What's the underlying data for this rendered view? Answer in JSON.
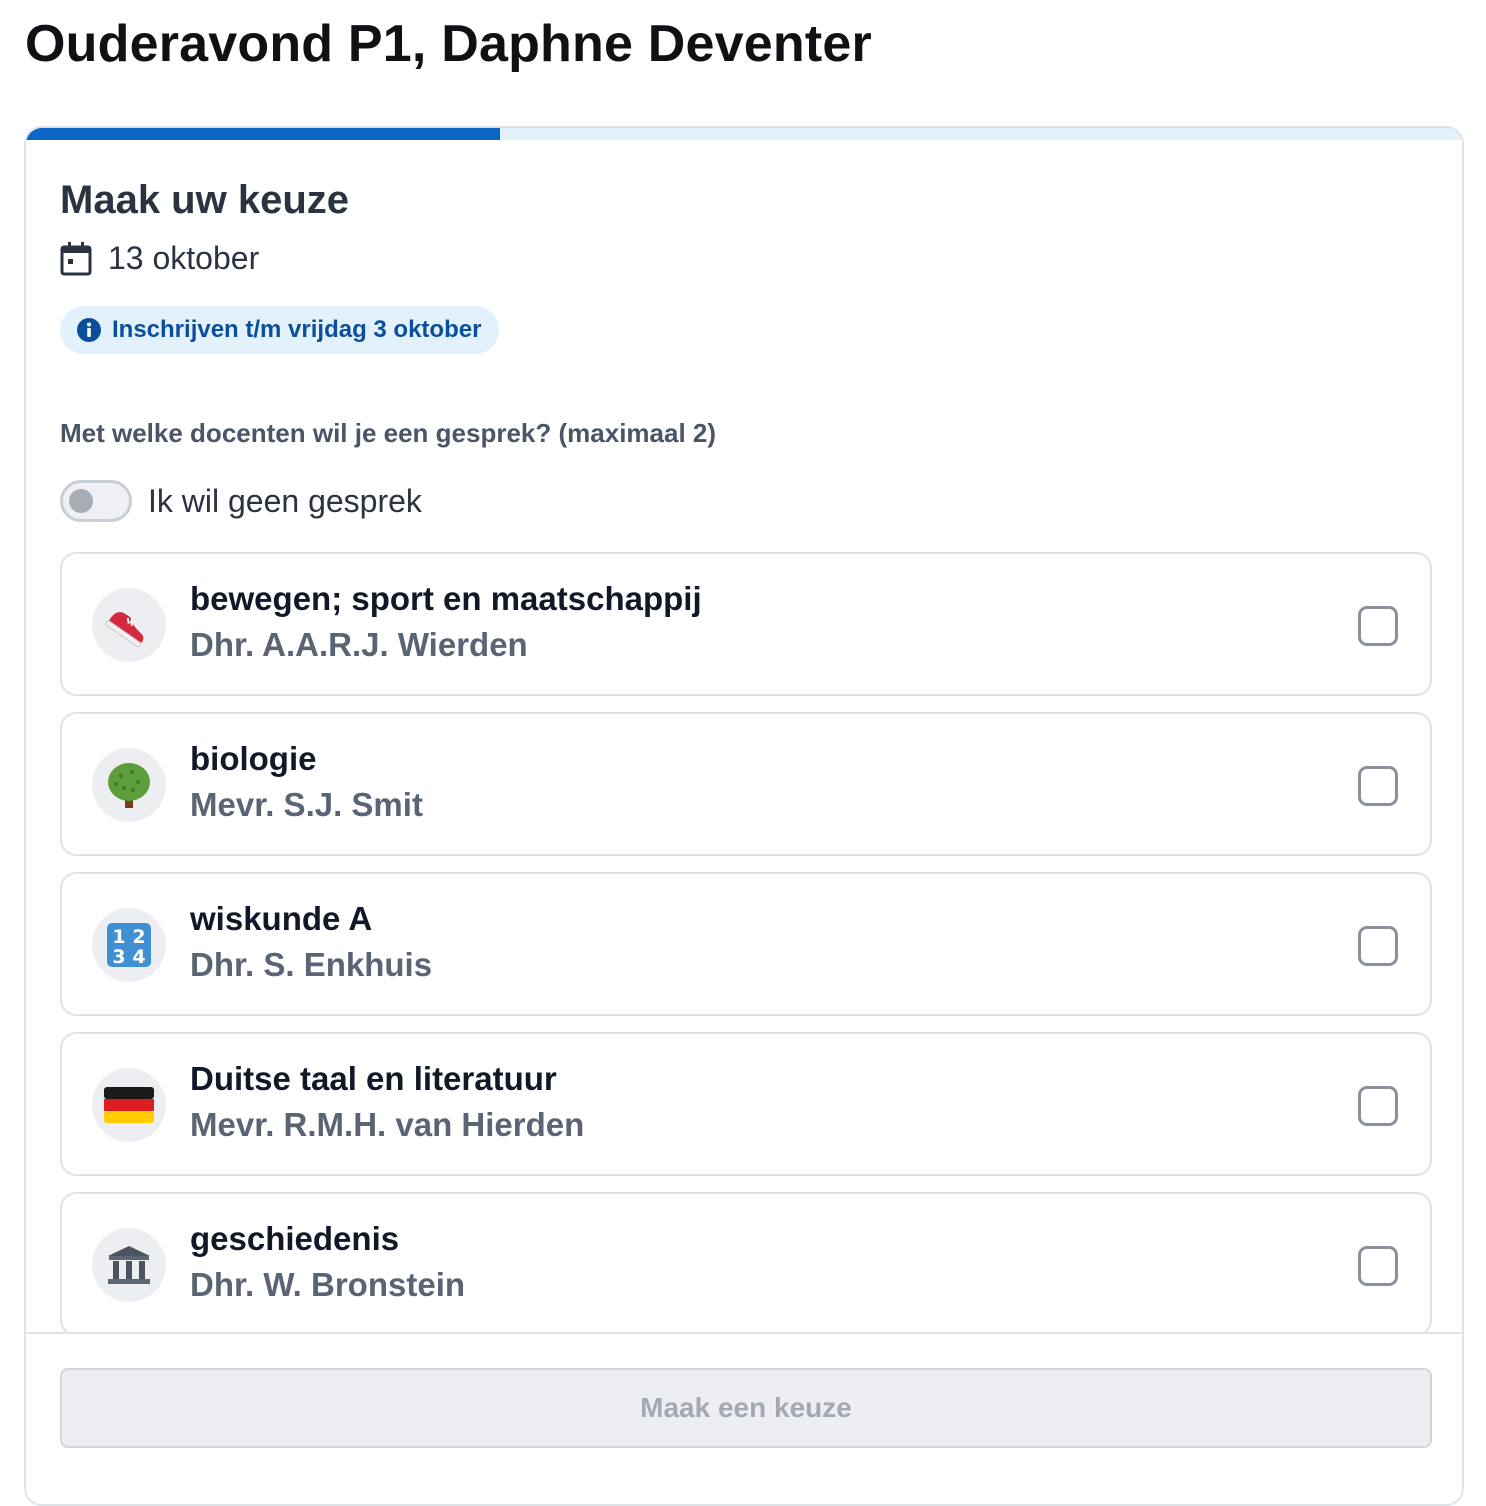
{
  "page": {
    "title": "Ouderavond P1, Daphne Deventer"
  },
  "progress": {
    "fraction": 0.33,
    "color": "#0b66c8"
  },
  "form": {
    "heading": "Maak uw keuze",
    "date": "13 oktober",
    "deadline": "Inschrijven t/m vrijdag 3 oktober",
    "question": "Met welke docenten wil je een gesprek? (maximaal 2)",
    "no_conversation_label": "Ik wil geen gesprek",
    "no_conversation_checked": false
  },
  "teachers": [
    {
      "subject": "bewegen; sport en maatschappij",
      "teacher": "Dhr. A.A.R.J. Wierden",
      "icon": "sneaker-icon",
      "checked": false
    },
    {
      "subject": "biologie",
      "teacher": "Mevr. S.J. Smit",
      "icon": "tree-icon",
      "checked": false
    },
    {
      "subject": "wiskunde A",
      "teacher": "Dhr. S. Enkhuis",
      "icon": "numbers-icon",
      "checked": false
    },
    {
      "subject": "Duitse taal en literatuur",
      "teacher": "Mevr. R.M.H. van Hierden",
      "icon": "german-flag-icon",
      "checked": false
    },
    {
      "subject": "geschiedenis",
      "teacher": "Dhr. W. Bronstein",
      "icon": "classical-building-icon",
      "checked": false
    }
  ],
  "submit": {
    "label": "Maak een keuze",
    "enabled": false
  }
}
